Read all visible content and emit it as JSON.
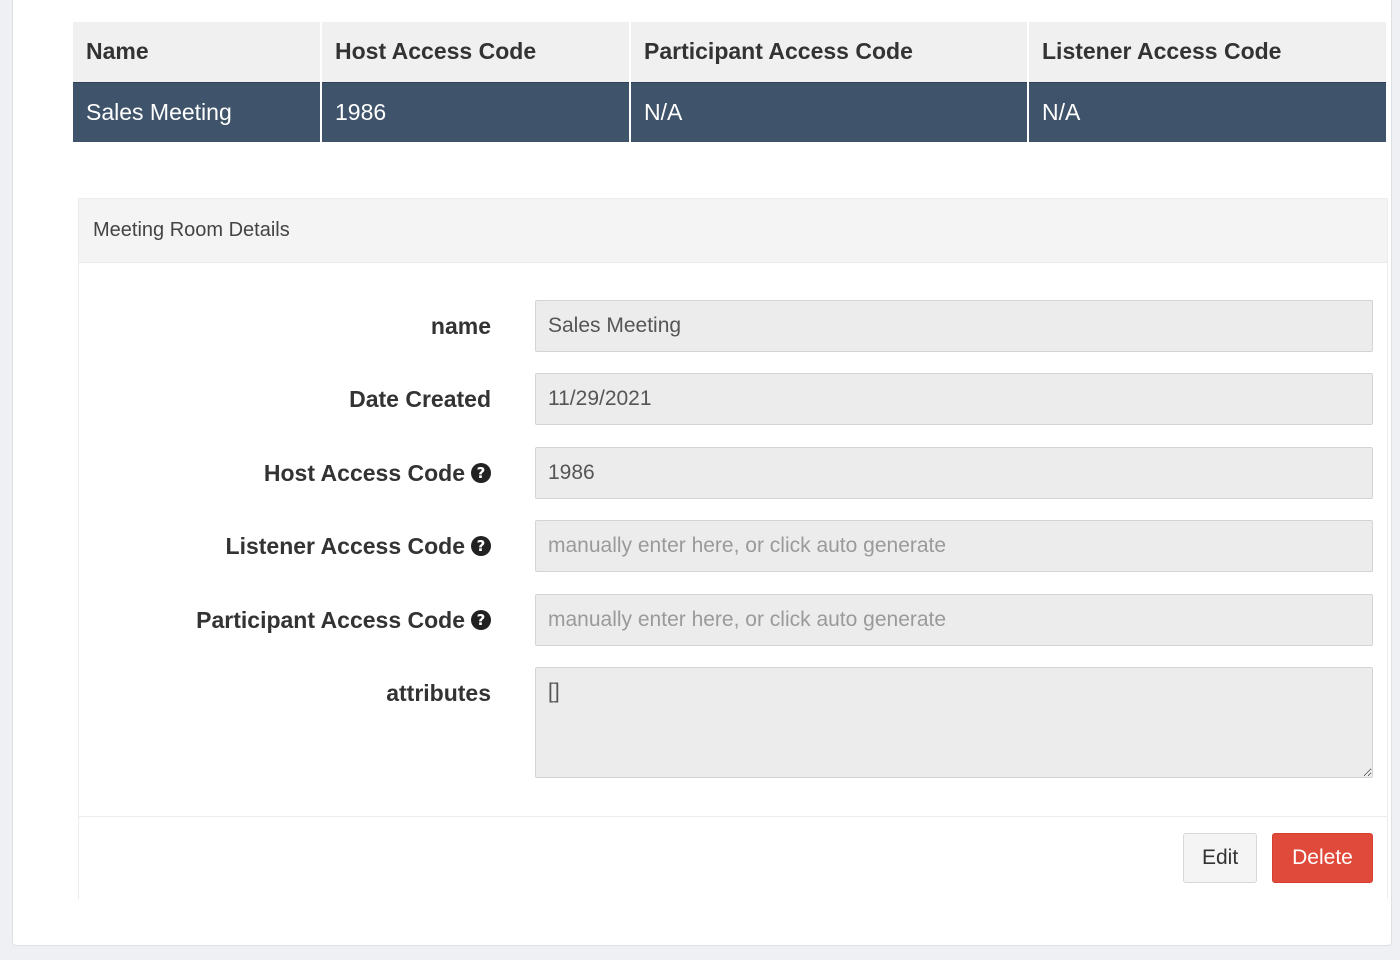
{
  "table": {
    "headers": [
      "Name",
      "Host Access Code",
      "Participant Access Code",
      "Listener Access Code"
    ],
    "rows": [
      [
        "Sales Meeting",
        "1986",
        "N/A",
        "N/A"
      ]
    ]
  },
  "details": {
    "heading": "Meeting Room Details",
    "fields": {
      "name": {
        "label": "name",
        "value": "Sales Meeting"
      },
      "date_created": {
        "label": "Date Created",
        "value": "11/29/2021"
      },
      "host_access_code": {
        "label": "Host Access Code",
        "value": "1986"
      },
      "listener_access_code": {
        "label": "Listener Access Code",
        "value": "",
        "placeholder": "manually enter here, or click auto generate"
      },
      "participant_access_code": {
        "label": "Participant Access Code",
        "value": "",
        "placeholder": "manually enter here, or click auto generate"
      },
      "attributes": {
        "label": "attributes",
        "value": "[]"
      }
    },
    "help_icon_glyph": "?",
    "buttons": {
      "edit": "Edit",
      "delete": "Delete"
    }
  },
  "colors": {
    "selected_row": "#3f536a",
    "delete_button": "#e04a3a"
  },
  "icons": {
    "help": "question-circle-icon"
  }
}
